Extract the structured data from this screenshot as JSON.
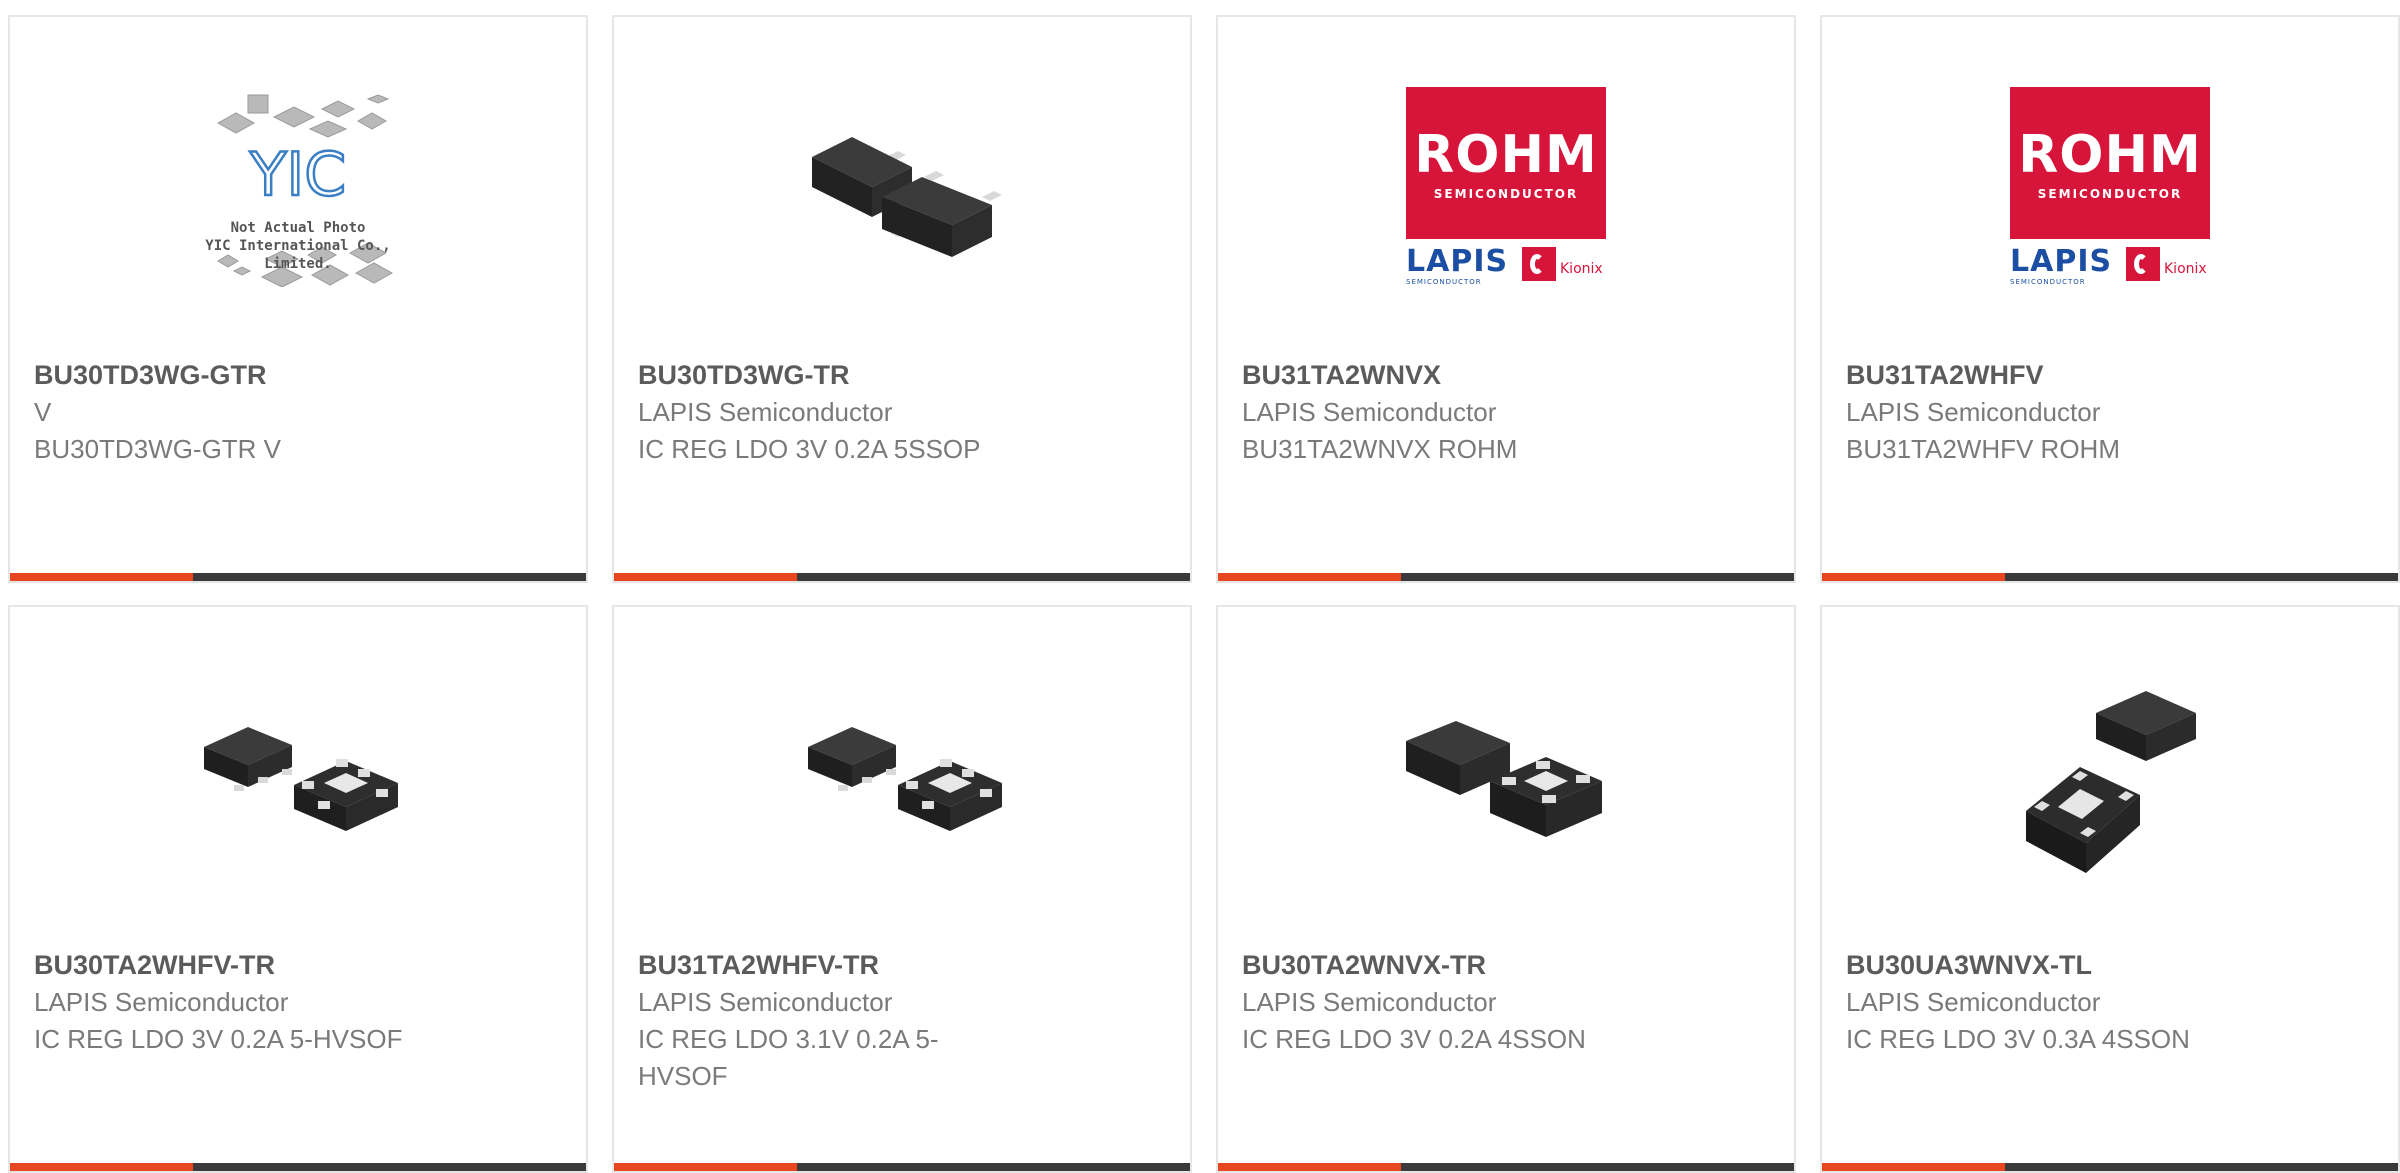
{
  "products": [
    {
      "part": "BU30TD3WG-GTR",
      "maker": "V",
      "desc": "BU30TD3WG-GTR V",
      "image": "not-actual-photo"
    },
    {
      "part": "BU30TD3WG-TR",
      "maker": "LAPIS Semiconductor",
      "desc": "IC REG LDO 3V 0.2A 5SSOP",
      "image": "ssop5-package"
    },
    {
      "part": "BU31TA2WNVX",
      "maker": "LAPIS Semiconductor",
      "desc": "BU31TA2WNVX ROHM",
      "image": "rohm-logo"
    },
    {
      "part": "BU31TA2WHFV",
      "maker": "LAPIS Semiconductor",
      "desc": "BU31TA2WHFV ROHM",
      "image": "rohm-logo"
    },
    {
      "part": "BU30TA2WHFV-TR",
      "maker": "LAPIS Semiconductor",
      "desc": "IC REG LDO 3V 0.2A 5-HVSOF",
      "image": "hvsof5-package"
    },
    {
      "part": "BU31TA2WHFV-TR",
      "maker": "LAPIS Semiconductor",
      "desc": "IC REG LDO 3.1V 0.2A 5-HVSOF",
      "image": "hvsof5-package"
    },
    {
      "part": "BU30TA2WNVX-TR",
      "maker": "LAPIS Semiconductor",
      "desc": "IC REG LDO 3V 0.2A 4SSON",
      "image": "sson4-package"
    },
    {
      "part": "BU30UA3WNVX-TL",
      "maker": "LAPIS Semiconductor",
      "desc": "IC REG LDO 3V 0.3A 4SSON",
      "image": "sson4-package-angled"
    }
  ],
  "placeholder_image": {
    "line1": "Not Actual Photo",
    "line2": "YIC International Co., Limited.",
    "logo": "YIC"
  },
  "rohm_logo": {
    "brand": "ROHM",
    "sub": "SEMICONDUCTOR",
    "lapis": "LAPIS",
    "lapis_sub": "SEMICONDUCTOR",
    "kionix": "Kionix"
  },
  "colors": {
    "accent": "#e8461e",
    "bar": "#3a3a3a",
    "rohm_red": "#d7153a",
    "lapis_blue": "#1c4fa3"
  }
}
